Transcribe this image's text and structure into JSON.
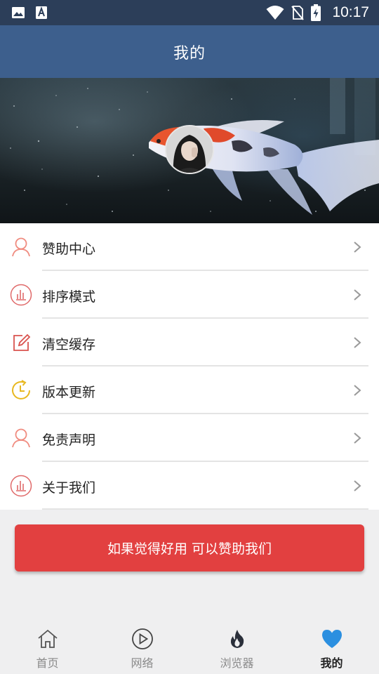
{
  "status_bar": {
    "time": "10:17",
    "icons": [
      "image-icon",
      "font-a-icon",
      "wifi-icon",
      "no-sim-icon",
      "battery-charging-icon"
    ]
  },
  "header": {
    "title": "我的"
  },
  "banner": {
    "image": "koi-fish-banner",
    "avatar": "user-avatar"
  },
  "menu": {
    "items": [
      {
        "label": "赞助中心",
        "icon": "person-outline-icon",
        "color": "#f08c80"
      },
      {
        "label": "排序模式",
        "icon": "bar-chart-circle-icon",
        "color": "#e06a6a"
      },
      {
        "label": "清空缓存",
        "icon": "edit-square-icon",
        "color": "#d9534f"
      },
      {
        "label": "版本更新",
        "icon": "clock-refresh-icon",
        "color": "#e8b820"
      },
      {
        "label": "免责声明",
        "icon": "person-outline-icon",
        "color": "#f08c80"
      },
      {
        "label": "关于我们",
        "icon": "bar-chart-circle-icon",
        "color": "#e06a6a"
      }
    ]
  },
  "sponsor_button": {
    "label": "如果觉得好用 可以赞助我们",
    "color": "#e24040"
  },
  "bottom_nav": {
    "items": [
      {
        "label": "首页",
        "icon": "home-icon"
      },
      {
        "label": "网络",
        "icon": "play-circle-icon"
      },
      {
        "label": "浏览器",
        "icon": "flame-icon"
      },
      {
        "label": "我的",
        "icon": "heart-icon",
        "active": true
      }
    ],
    "active_color": "#2b8fe0"
  }
}
